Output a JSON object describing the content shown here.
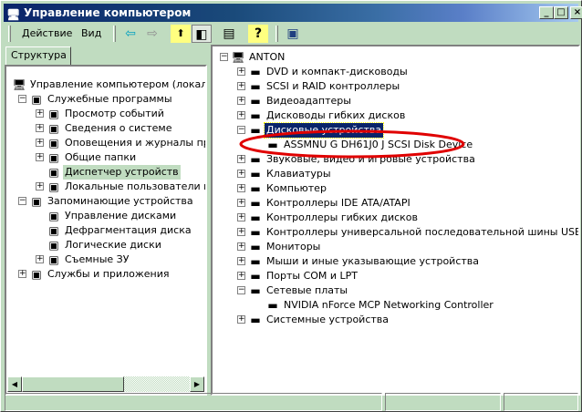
{
  "window": {
    "title": "Управление компьютером",
    "minimize": "_",
    "maximize": "□",
    "close": "×"
  },
  "menu": {
    "action": "Действие",
    "view": "Вид"
  },
  "toolbar": {
    "back": "⇦",
    "forward": "⇨",
    "up": "⬆",
    "show_tree": "◧",
    "properties": "▤",
    "help": "?",
    "device": "▣"
  },
  "left": {
    "tab": "Структура",
    "items": [
      {
        "label": "Управление компьютером (локальным",
        "level": 0,
        "exp": ""
      },
      {
        "label": "Служебные программы",
        "level": 1,
        "exp": "−"
      },
      {
        "label": "Просмотр событий",
        "level": 2,
        "exp": "+"
      },
      {
        "label": "Сведения о системе",
        "level": 2,
        "exp": "+"
      },
      {
        "label": "Оповещения и журналы произв",
        "level": 2,
        "exp": "+"
      },
      {
        "label": "Общие папки",
        "level": 2,
        "exp": "+"
      },
      {
        "label": "Диспетчер устройств",
        "level": 2,
        "exp": "",
        "selected": true
      },
      {
        "label": "Локальные пользователи и гру",
        "level": 2,
        "exp": "+"
      },
      {
        "label": "Запоминающие устройства",
        "level": 1,
        "exp": "−"
      },
      {
        "label": "Управление дисками",
        "level": 2,
        "exp": ""
      },
      {
        "label": "Дефрагментация диска",
        "level": 2,
        "exp": ""
      },
      {
        "label": "Логические диски",
        "level": 2,
        "exp": ""
      },
      {
        "label": "Съемные ЗУ",
        "level": 2,
        "exp": "+"
      },
      {
        "label": "Службы и приложения",
        "level": 1,
        "exp": "+"
      }
    ]
  },
  "right": {
    "items": [
      {
        "label": "ANTON",
        "level": 0,
        "exp": "−"
      },
      {
        "label": "DVD и компакт-дисководы",
        "level": 1,
        "exp": "+"
      },
      {
        "label": "SCSI и RAID контроллеры",
        "level": 1,
        "exp": "+"
      },
      {
        "label": "Видеоадаптеры",
        "level": 1,
        "exp": "+"
      },
      {
        "label": "Дисководы гибких дисков",
        "level": 1,
        "exp": "+"
      },
      {
        "label": "Дисковые устройства",
        "level": 1,
        "exp": "−",
        "highlight": true
      },
      {
        "label": "ASSMNU G DH61J0 J SCSI Disk Device",
        "level": 2,
        "exp": "",
        "circled": true
      },
      {
        "label": "Звуковые, видео и игровые устройства",
        "level": 1,
        "exp": "+"
      },
      {
        "label": "Клавиатуры",
        "level": 1,
        "exp": "+"
      },
      {
        "label": "Компьютер",
        "level": 1,
        "exp": "+"
      },
      {
        "label": "Контроллеры IDE ATA/ATAPI",
        "level": 1,
        "exp": "+"
      },
      {
        "label": "Контроллеры гибких дисков",
        "level": 1,
        "exp": "+"
      },
      {
        "label": "Контроллеры универсальной последовательной шины USB",
        "level": 1,
        "exp": "+"
      },
      {
        "label": "Мониторы",
        "level": 1,
        "exp": "+"
      },
      {
        "label": "Мыши и иные указывающие устройства",
        "level": 1,
        "exp": "+"
      },
      {
        "label": "Порты COM и LPT",
        "level": 1,
        "exp": "+"
      },
      {
        "label": "Сетевые платы",
        "level": 1,
        "exp": "−"
      },
      {
        "label": "NVIDIA nForce MCP Networking Controller",
        "level": 2,
        "exp": ""
      },
      {
        "label": "Системные устройства",
        "level": 1,
        "exp": "+"
      }
    ]
  },
  "colors": {
    "annotation": "#e00000",
    "selection": "#0a246a",
    "background": "#c0dcc0"
  }
}
